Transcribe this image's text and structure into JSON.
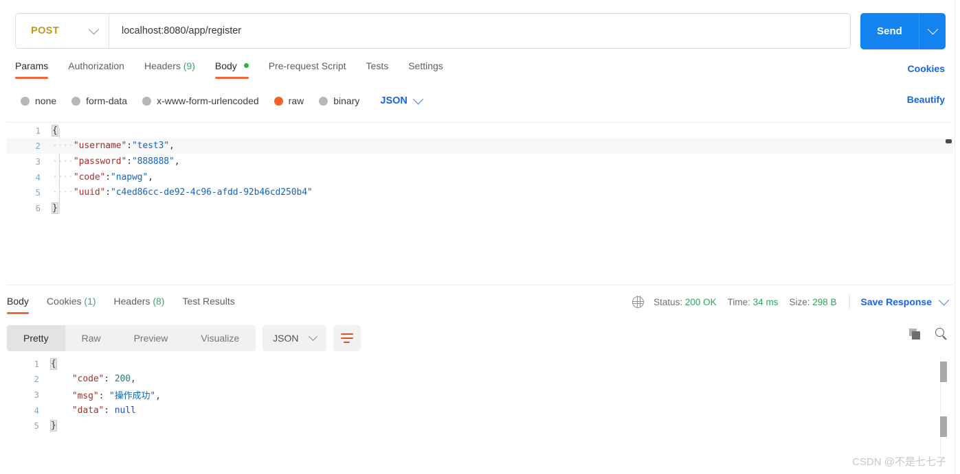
{
  "request": {
    "method": "POST",
    "url": "localhost:8080/app/register",
    "send_label": "Send",
    "send_caret_icon": "chevron-down-icon",
    "method_caret_icon": "chevron-down-icon",
    "tabs": [
      {
        "label": "Params",
        "count": "",
        "active": false,
        "dot": false
      },
      {
        "label": "Authorization",
        "count": "",
        "active": false,
        "dot": false
      },
      {
        "label": "Headers",
        "count": "(9)",
        "active": false,
        "dot": false
      },
      {
        "label": "Body",
        "count": "",
        "active": true,
        "dot": true
      },
      {
        "label": "Pre-request Script",
        "count": "",
        "active": false,
        "dot": false
      },
      {
        "label": "Tests",
        "count": "",
        "active": false,
        "dot": false
      },
      {
        "label": "Settings",
        "count": "",
        "active": false,
        "dot": false
      }
    ],
    "cookies_link": "Cookies",
    "beautify_link": "Beautify",
    "body_types": [
      {
        "label": "none",
        "selected": false
      },
      {
        "label": "form-data",
        "selected": false
      },
      {
        "label": "x-www-form-urlencoded",
        "selected": false
      },
      {
        "label": "raw",
        "selected": true
      },
      {
        "label": "binary",
        "selected": false
      }
    ],
    "raw_format": "JSON",
    "raw_format_caret_icon": "chevron-down-icon",
    "body_lines": [
      {
        "n": "1",
        "tokens": [
          {
            "t": "{",
            "c": "brace-hl"
          }
        ]
      },
      {
        "n": "2",
        "tokens": [
          {
            "t": "····",
            "c": "indent"
          },
          {
            "t": "\"username\"",
            "c": "k"
          },
          {
            "t": ":",
            "c": "p"
          },
          {
            "t": "\"test3\"",
            "c": "s"
          },
          {
            "t": ",",
            "c": "p"
          }
        ]
      },
      {
        "n": "3",
        "tokens": [
          {
            "t": "····",
            "c": "indent"
          },
          {
            "t": "\"password\"",
            "c": "k"
          },
          {
            "t": ":",
            "c": "p"
          },
          {
            "t": "\"888888\"",
            "c": "s"
          },
          {
            "t": ",",
            "c": "p"
          }
        ]
      },
      {
        "n": "4",
        "tokens": [
          {
            "t": "····",
            "c": "indent"
          },
          {
            "t": "\"code\"",
            "c": "k"
          },
          {
            "t": ":",
            "c": "p"
          },
          {
            "t": "\"napwg\"",
            "c": "s"
          },
          {
            "t": ",",
            "c": "p"
          }
        ]
      },
      {
        "n": "5",
        "tokens": [
          {
            "t": "····",
            "c": "indent"
          },
          {
            "t": "\"uuid\"",
            "c": "k"
          },
          {
            "t": ":",
            "c": "p"
          },
          {
            "t": "\"c4ed86cc-de92-4c96-afdd-92b46cd250b4\"",
            "c": "s"
          }
        ]
      },
      {
        "n": "6",
        "tokens": [
          {
            "t": "}",
            "c": "brace-hl"
          }
        ]
      }
    ]
  },
  "response": {
    "tabs": [
      {
        "label": "Body",
        "count": "",
        "active": true
      },
      {
        "label": "Cookies",
        "count": "(1)",
        "active": false
      },
      {
        "label": "Headers",
        "count": "(8)",
        "active": false
      },
      {
        "label": "Test Results",
        "count": "",
        "active": false
      }
    ],
    "globe_icon": "globe-icon",
    "status_label": "Status:",
    "status_value": "200 OK",
    "time_label": "Time:",
    "time_value": "34 ms",
    "size_label": "Size:",
    "size_value": "298 B",
    "save_response_label": "Save Response",
    "save_response_caret_icon": "chevron-down-icon",
    "view_modes": [
      {
        "label": "Pretty",
        "active": true
      },
      {
        "label": "Raw",
        "active": false
      },
      {
        "label": "Preview",
        "active": false
      },
      {
        "label": "Visualize",
        "active": false
      }
    ],
    "format": "JSON",
    "format_caret_icon": "chevron-down-icon",
    "wrap_icon": "word-wrap-icon",
    "copy_icon": "copy-icon",
    "search_icon": "search-icon",
    "body_lines": [
      {
        "n": "1",
        "tokens": [
          {
            "t": "{",
            "c": "brace-hl"
          }
        ]
      },
      {
        "n": "2",
        "tokens": [
          {
            "t": "    ",
            "c": "p"
          },
          {
            "t": "\"code\"",
            "c": "k"
          },
          {
            "t": ": ",
            "c": "p"
          },
          {
            "t": "200",
            "c": "num"
          },
          {
            "t": ",",
            "c": "p"
          }
        ]
      },
      {
        "n": "3",
        "tokens": [
          {
            "t": "    ",
            "c": "p"
          },
          {
            "t": "\"msg\"",
            "c": "k"
          },
          {
            "t": ": ",
            "c": "p"
          },
          {
            "t": "\"操作成功\"",
            "c": "s"
          },
          {
            "t": ",",
            "c": "p"
          }
        ]
      },
      {
        "n": "4",
        "tokens": [
          {
            "t": "    ",
            "c": "p"
          },
          {
            "t": "\"data\"",
            "c": "k"
          },
          {
            "t": ": ",
            "c": "p"
          },
          {
            "t": "null",
            "c": "nul"
          }
        ]
      },
      {
        "n": "5",
        "tokens": [
          {
            "t": "}",
            "c": "brace-hl"
          }
        ]
      }
    ]
  },
  "watermark": "CSDN @不是七七子",
  "colors": {
    "accent_orange": "#f1663a",
    "link_blue": "#1765e0",
    "send_blue": "#1283ef",
    "method_amber": "#bd9a19",
    "success_green": "#2fa35e"
  }
}
